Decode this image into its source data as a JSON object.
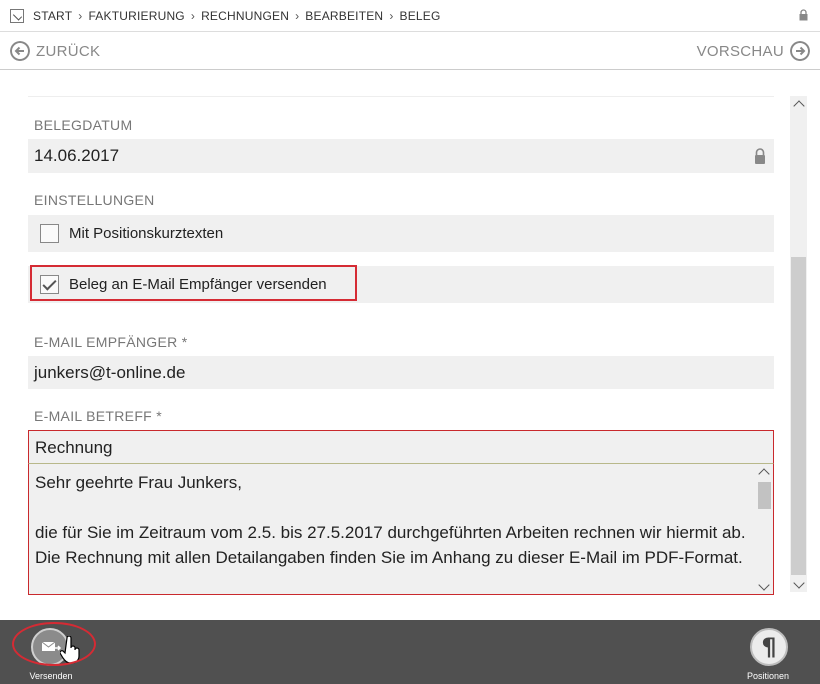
{
  "breadcrumb": {
    "items": [
      "START",
      "FAKTURIERUNG",
      "RECHNUNGEN",
      "BEARBEITEN",
      "BELEG"
    ],
    "separator": "›"
  },
  "nav": {
    "back_label": "ZURÜCK",
    "forward_label": "VORSCHAU"
  },
  "form": {
    "belegdatum": {
      "label": "BELEGDATUM",
      "value": "14.06.2017"
    },
    "einstellungen": {
      "label": "EINSTELLUNGEN",
      "options": [
        {
          "label": "Mit Positionskurztexten",
          "checked": false
        },
        {
          "label": "Beleg an E-Mail Empfänger versenden",
          "checked": true
        }
      ]
    },
    "email_empfaenger": {
      "label": "E-MAIL EMPFÄNGER *",
      "value": "junkers@t-online.de"
    },
    "email_betreff": {
      "label": "E-MAIL BETREFF *",
      "subject": "Rechnung",
      "body": [
        "Sehr geehrte Frau Junkers,",
        "",
        "die für Sie im Zeitraum vom 2.5. bis 27.5.2017 durchgeführten Arbeiten rechnen wir hiermit ab. Die Rechnung mit allen Detailangaben finden Sie im Anhang zu dieser E-Mail im PDF-Format."
      ]
    }
  },
  "toolbar": {
    "send_label": "Versenden",
    "positions_label": "Positionen",
    "positions_glyph": "¶",
    "send_icon": "envelope-forward-icon"
  },
  "colors": {
    "highlight": "#d52b34",
    "toolbar_bg": "#505050",
    "field_bg": "#f0f0f0"
  }
}
